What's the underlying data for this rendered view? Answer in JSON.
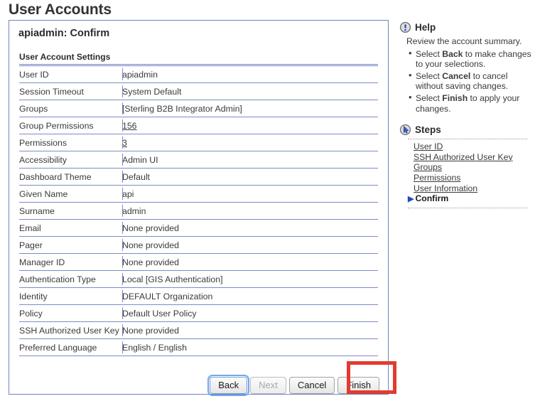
{
  "page": {
    "title": "User Accounts"
  },
  "panel": {
    "heading": "apiadmin: Confirm",
    "section_title": "User Account Settings",
    "rows": [
      {
        "label": "User ID",
        "value": "apiadmin",
        "link": false
      },
      {
        "label": "Session Timeout",
        "value": "System Default",
        "link": false
      },
      {
        "label": "Groups",
        "value": "[Sterling B2B Integrator Admin]",
        "link": false
      },
      {
        "label": "Group Permissions",
        "value": "156",
        "link": true
      },
      {
        "label": "Permissions",
        "value": "3",
        "link": true
      },
      {
        "label": "Accessibility",
        "value": "Admin UI",
        "link": false
      },
      {
        "label": "Dashboard Theme",
        "value": "Default",
        "link": false
      },
      {
        "label": "Given Name",
        "value": "api",
        "link": false
      },
      {
        "label": "Surname",
        "value": "admin",
        "link": false
      },
      {
        "label": "Email",
        "value": "None provided",
        "link": false
      },
      {
        "label": "Pager",
        "value": "None provided",
        "link": false
      },
      {
        "label": "Manager ID",
        "value": "None provided",
        "link": false
      },
      {
        "label": "Authentication Type",
        "value": "Local [GIS Authentication]",
        "link": false
      },
      {
        "label": "Identity",
        "value": "DEFAULT Organization",
        "link": false
      },
      {
        "label": "Policy",
        "value": "Default User Policy",
        "link": false
      },
      {
        "label": "SSH Authorized User Key",
        "value": "None provided",
        "link": false
      },
      {
        "label": "Preferred Language",
        "value": "English / English",
        "link": false
      }
    ]
  },
  "buttons": {
    "back": "Back",
    "next": "Next",
    "cancel": "Cancel",
    "finish": "Finish"
  },
  "help": {
    "title": "Help",
    "intro": "Review the account summary.",
    "items": [
      {
        "pre": "Select ",
        "strong": "Back",
        "post": " to make changes to your selections."
      },
      {
        "pre": "Select ",
        "strong": "Cancel",
        "post": " to cancel without saving changes."
      },
      {
        "pre": "Select ",
        "strong": "Finish",
        "post": " to apply your changes."
      }
    ]
  },
  "steps": {
    "title": "Steps",
    "items": [
      {
        "label": "User ID",
        "current": false
      },
      {
        "label": "SSH Authorized User Key",
        "current": false
      },
      {
        "label": "Groups",
        "current": false
      },
      {
        "label": "Permissions",
        "current": false
      },
      {
        "label": "User Information",
        "current": false
      },
      {
        "label": "Confirm",
        "current": true
      }
    ]
  },
  "colors": {
    "panel_border": "#7183c4",
    "row_rule": "#7b8cc9",
    "highlight_box": "#e23b30",
    "focus_ring": "#6ea8f0"
  }
}
